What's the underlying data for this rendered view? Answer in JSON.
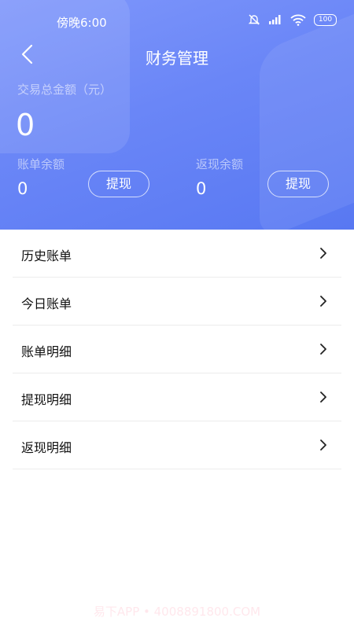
{
  "status_bar": {
    "time": "傍晚6:00",
    "battery": "100"
  },
  "header": {
    "title": "财务管理",
    "total_label": "交易总金额（元）",
    "total_value": "0",
    "bill_balance_label": "账单余额",
    "bill_balance_value": "0",
    "cashback_balance_label": "返现余额",
    "cashback_balance_value": "0",
    "withdraw_label": "提现"
  },
  "menu": {
    "items": [
      {
        "label": "历史账单"
      },
      {
        "label": "今日账单"
      },
      {
        "label": "账单明细"
      },
      {
        "label": "提现明细"
      },
      {
        "label": "返现明细"
      }
    ]
  },
  "watermark": "易下APP • 4008891800.COM",
  "colors": {
    "header_start": "#7f97fb",
    "header_end": "#5878f2",
    "text": "#111111",
    "divider": "#ececec"
  }
}
